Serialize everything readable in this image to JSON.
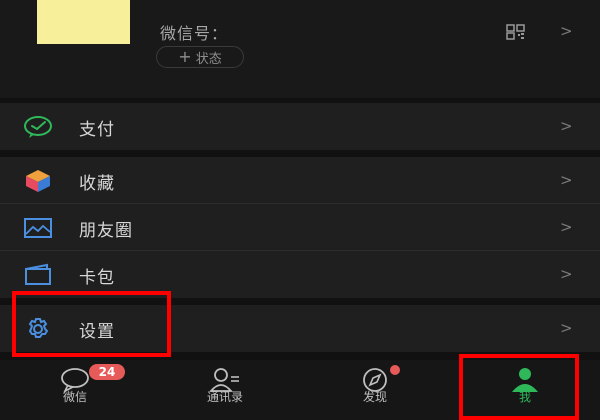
{
  "profile": {
    "wechat_id_label": "微信号：",
    "qr_icon": "qr-code-icon",
    "status_button": "状态"
  },
  "menu": {
    "items": [
      {
        "label": "支付",
        "icon": "payment-icon"
      },
      {
        "label": "收藏",
        "icon": "favorites-icon"
      },
      {
        "label": "朋友圈",
        "icon": "moments-icon"
      },
      {
        "label": "卡包",
        "icon": "card-wallet-icon"
      },
      {
        "label": "设置",
        "icon": "settings-icon"
      }
    ]
  },
  "tabbar": {
    "tabs": [
      {
        "label": "微信",
        "badge": "24"
      },
      {
        "label": "通讯录"
      },
      {
        "label": "发现"
      },
      {
        "label": "我",
        "active": true
      }
    ]
  },
  "colors": {
    "accent_green": "#2fb85a",
    "badge_red": "#e75a5a",
    "highlight_box": "#ff0000"
  }
}
